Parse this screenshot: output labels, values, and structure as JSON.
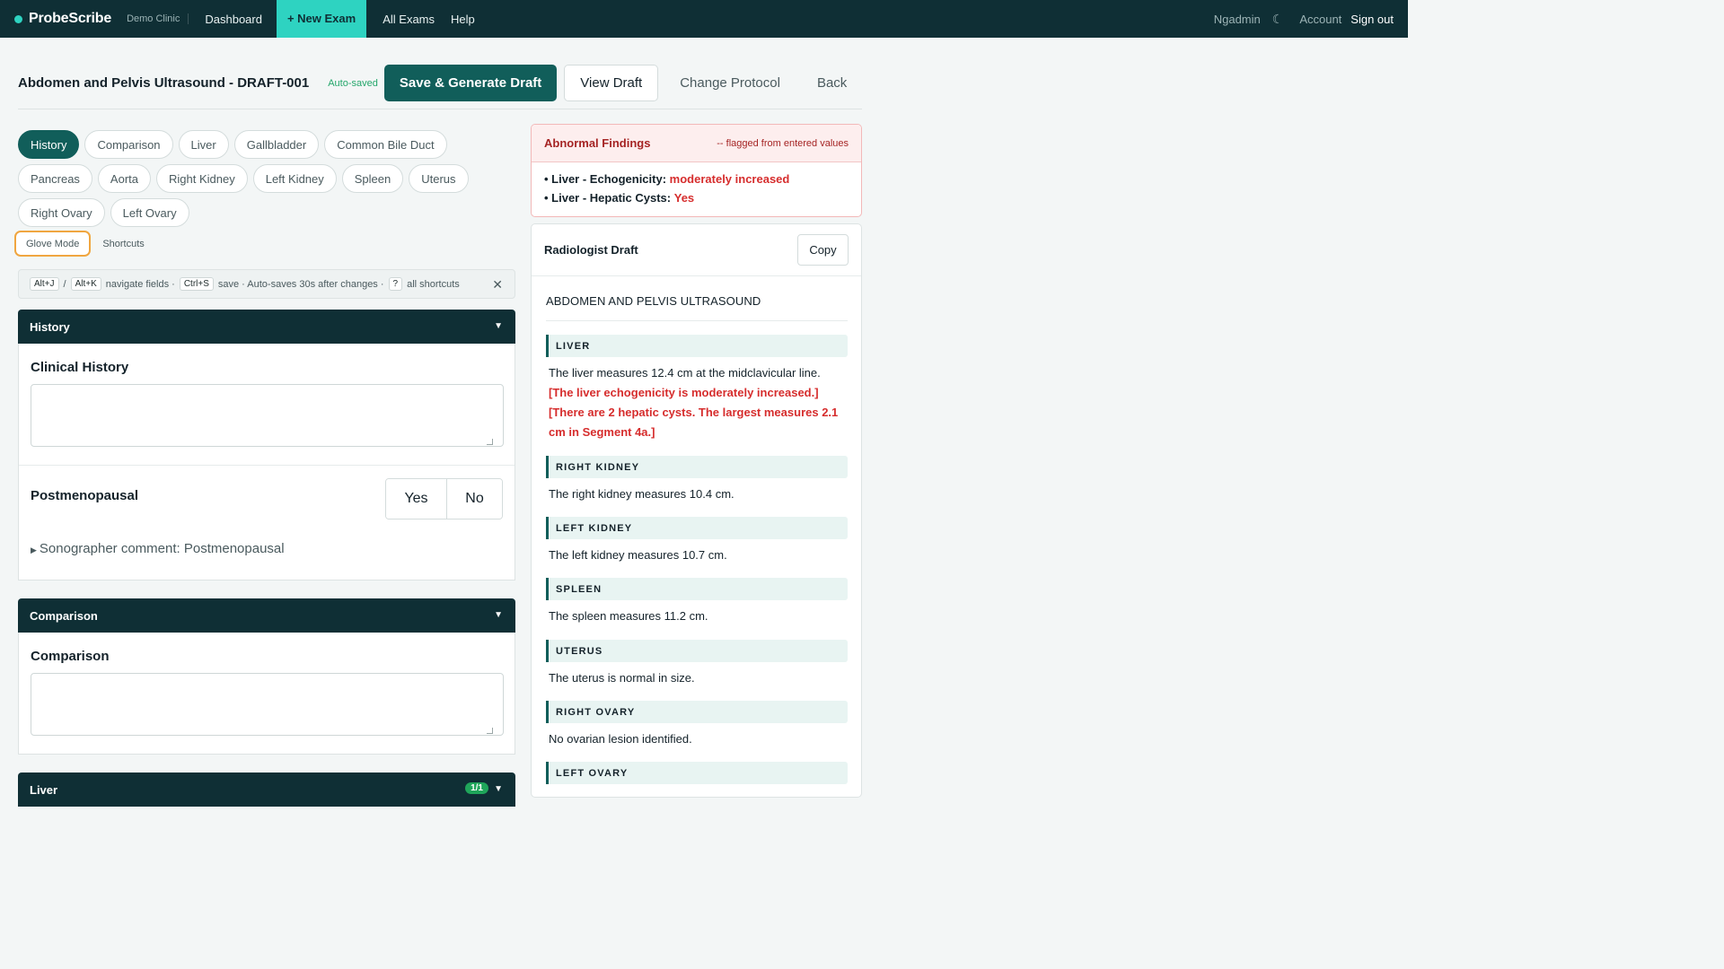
{
  "nav": {
    "brand": "ProbeScribe",
    "clinic": "Demo Clinic",
    "dashboard": "Dashboard",
    "new_exam": "+ New Exam",
    "all_exams": "All Exams",
    "help": "Help",
    "user": "Ngadmin",
    "theme_icon": "☾",
    "account": "Account",
    "sign_out": "Sign out"
  },
  "header": {
    "title": "Abdomen and Pelvis Ultrasound - DRAFT-001",
    "autosave_status": "Auto-saved",
    "save_button": "Save & Generate Draft",
    "view_draft_button": "View Draft",
    "change_protocol_button": "Change Protocol",
    "back_button": "Back"
  },
  "sections": [
    "History",
    "Comparison",
    "Liver",
    "Gallbladder",
    "Common Bile Duct",
    "Pancreas",
    "Aorta",
    "Right Kidney",
    "Left Kidney",
    "Spleen",
    "Uterus",
    "Right Ovary",
    "Left Ovary"
  ],
  "active_section": "History",
  "tools": {
    "glove_mode": "Glove Mode",
    "shortcuts": "Shortcuts"
  },
  "hint": {
    "key_next": "Alt+J",
    "sep": "/",
    "key_prev": "Alt+K",
    "navigate": "navigate fields ·",
    "key_save": "Ctrl+S",
    "save_text": "save · Auto-saves 30s after changes ·",
    "key_help": "?",
    "all_shortcuts": "all shortcuts",
    "close_icon": "✕"
  },
  "panels": {
    "history": {
      "title": "History",
      "clinical_history_label": "Clinical History",
      "clinical_history_value": "",
      "postmenopausal_label": "Postmenopausal",
      "yes": "Yes",
      "no": "No",
      "comment": "Sonographer comment: Postmenopausal"
    },
    "comparison": {
      "title": "Comparison",
      "comparison_label": "Comparison",
      "comparison_value": ""
    },
    "liver": {
      "title": "Liver",
      "badge": "1/1"
    }
  },
  "abnormal": {
    "title": "Abnormal Findings",
    "note": "-- flagged from entered values",
    "items": [
      {
        "label": "Liver - Echogenicity:",
        "value": "moderately increased"
      },
      {
        "label": "Liver - Hepatic Cysts:",
        "value": "Yes"
      }
    ]
  },
  "draft": {
    "title": "Radiologist Draft",
    "copy_button": "Copy",
    "report_title": "ABDOMEN AND PELVIS ULTRASOUND",
    "sections": [
      {
        "heading": "LIVER",
        "line1": "The liver measures 12.4 cm at the midclavicular line.",
        "abn1": "[The liver echogenicity is moderately increased.]",
        "abn2": "[There are 2 hepatic cysts. The largest measures 2.1 cm in Segment 4a.]"
      },
      {
        "heading": "RIGHT KIDNEY",
        "line1": "The right kidney measures 10.4 cm."
      },
      {
        "heading": "LEFT KIDNEY",
        "line1": "The left kidney measures 10.7 cm."
      },
      {
        "heading": "SPLEEN",
        "line1": "The spleen measures 11.2 cm."
      },
      {
        "heading": "UTERUS",
        "line1": "The uterus is normal in size."
      },
      {
        "heading": "RIGHT OVARY",
        "line1": "No ovarian lesion identified."
      },
      {
        "heading": "LEFT OVARY"
      }
    ]
  }
}
